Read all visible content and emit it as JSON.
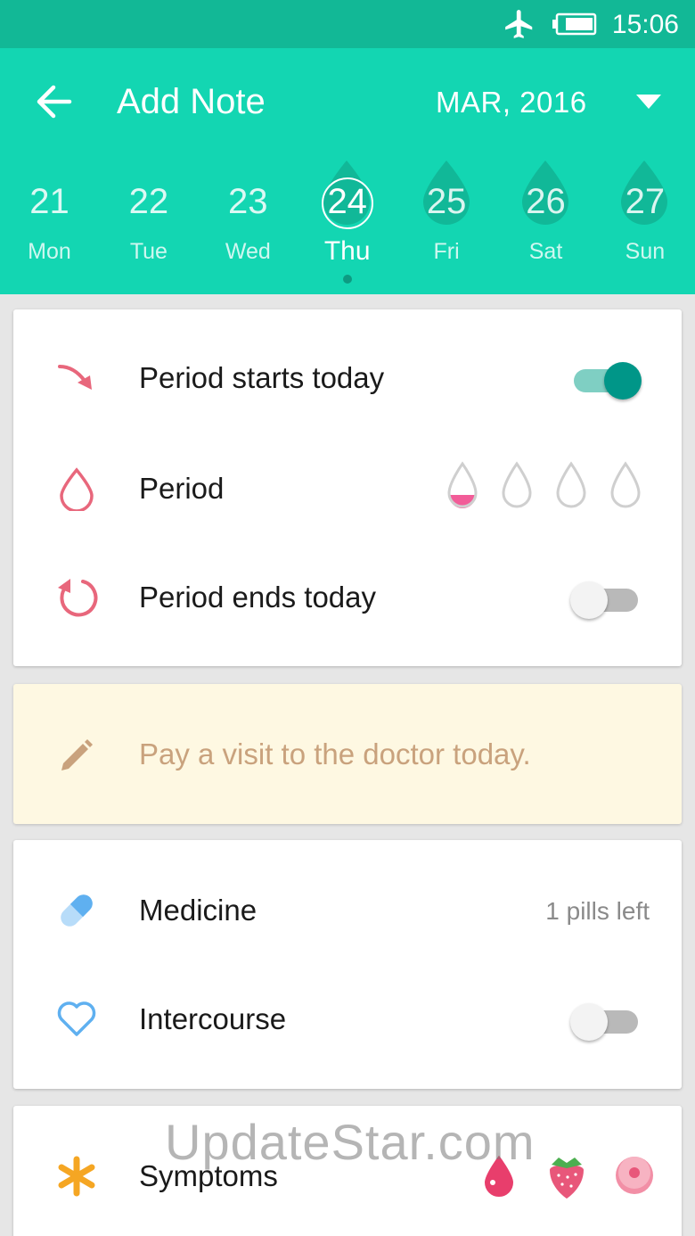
{
  "status_bar": {
    "time": "15:06",
    "icons": [
      "airplane-mode-icon",
      "battery-icon"
    ]
  },
  "header": {
    "back_icon": "arrow-left-icon",
    "title": "Add Note",
    "month": "MAR, 2016",
    "dropdown_icon": "triangle-down-icon"
  },
  "days": [
    {
      "num": "21",
      "name": "Mon",
      "drop": false,
      "selected": false
    },
    {
      "num": "22",
      "name": "Tue",
      "drop": false,
      "selected": false
    },
    {
      "num": "23",
      "name": "Wed",
      "drop": false,
      "selected": false
    },
    {
      "num": "24",
      "name": "Thu",
      "drop": true,
      "selected": true
    },
    {
      "num": "25",
      "name": "Fri",
      "drop": true,
      "selected": false
    },
    {
      "num": "26",
      "name": "Sat",
      "drop": true,
      "selected": false
    },
    {
      "num": "27",
      "name": "Sun",
      "drop": true,
      "selected": false
    }
  ],
  "period_card": {
    "starts": {
      "label": "Period starts today",
      "icon": "arrow-curve-down-icon",
      "enabled": true
    },
    "period": {
      "label": "Period",
      "icon": "drop-outline-icon",
      "flow_level": 1,
      "flow_max": 4
    },
    "ends": {
      "label": "Period ends today",
      "icon": "refresh-icon",
      "enabled": false
    }
  },
  "note": {
    "icon": "pencil-icon",
    "text": "Pay a visit to the doctor today."
  },
  "health_card": {
    "medicine": {
      "label": "Medicine",
      "icon": "pill-icon",
      "status": "1 pills left"
    },
    "intercourse": {
      "label": "Intercourse",
      "icon": "heart-outline-icon",
      "enabled": false
    }
  },
  "symptoms": {
    "label": "Symptoms",
    "icon": "asterisk-icon",
    "items": [
      "blood-drop-icon",
      "strawberry-icon",
      "donut-icon"
    ]
  },
  "watermark": "UpdateStar.com",
  "colors": {
    "header": "#13d6b2",
    "status_bar": "#12b896",
    "accent": "#009688",
    "pink": "#e8677c",
    "note_bg": "#fef8e2",
    "note_text": "#c9a27d"
  }
}
